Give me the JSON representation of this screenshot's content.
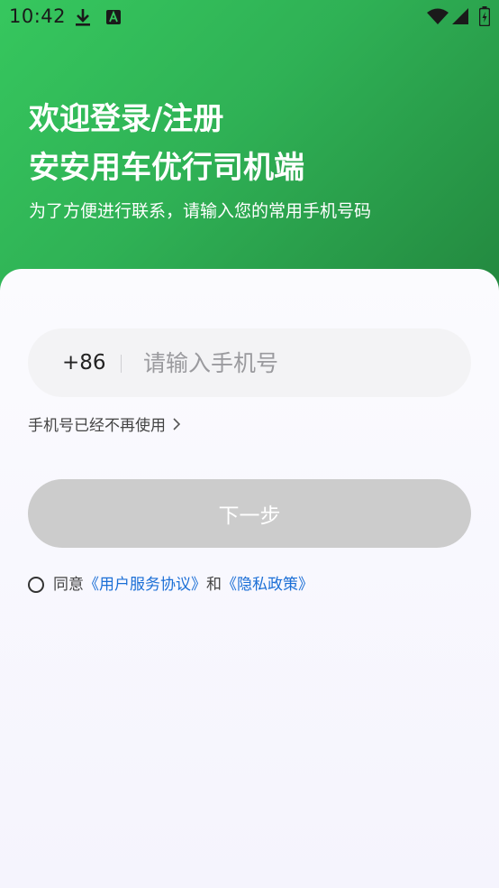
{
  "status_bar": {
    "time": "10:42"
  },
  "header": {
    "welcome_title": "欢迎登录/注册",
    "app_name": "安安用车优行司机端",
    "subtitle": "为了方便进行联系，请输入您的常用手机号码"
  },
  "form": {
    "country_code": "+86",
    "phone_placeholder": "请输入手机号",
    "phone_value": "",
    "unused_link": "手机号已经不再使用",
    "next_button": "下一步"
  },
  "agreement": {
    "prefix": "同意",
    "user_agreement": "《用户服务协议》",
    "conjunction": "和",
    "privacy_policy": "《隐私政策》"
  },
  "colors": {
    "brand_green": "#2fb155",
    "link_blue": "#1b6fd6",
    "disabled_button": "#cccccc"
  },
  "icons": {
    "status_download": "download-icon",
    "status_notification": "notification-a-icon",
    "status_wifi": "wifi-icon",
    "status_signal": "signal-icon",
    "status_battery": "battery-icon",
    "unused_chevron": "chevron-right-icon",
    "agree_radio": "radio-unchecked-icon"
  }
}
